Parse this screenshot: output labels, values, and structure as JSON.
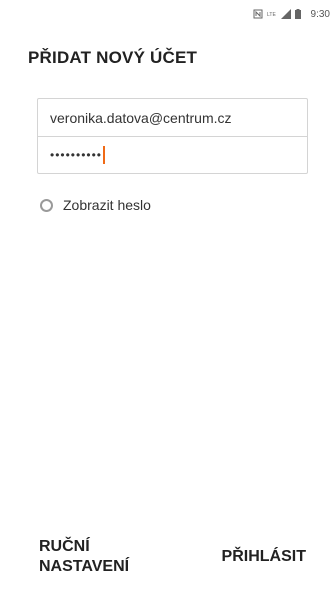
{
  "status_bar": {
    "icons": [
      "nfc-icon",
      "lte-icon",
      "signal-icon",
      "battery-icon"
    ],
    "time": "9:30"
  },
  "page": {
    "title": "PŘIDAT NOVÝ ÚČET"
  },
  "form": {
    "email_value": "veronika.datova@centrum.cz",
    "password_masked": "••••••••••",
    "show_password_label": "Zobrazit heslo",
    "show_password_checked": false
  },
  "actions": {
    "manual_setup_label": "RUČNÍ NASTAVENÍ",
    "login_label": "PŘIHLÁSIT"
  },
  "colors": {
    "caret": "#f06a16",
    "field_border": "#d4d4d4"
  }
}
